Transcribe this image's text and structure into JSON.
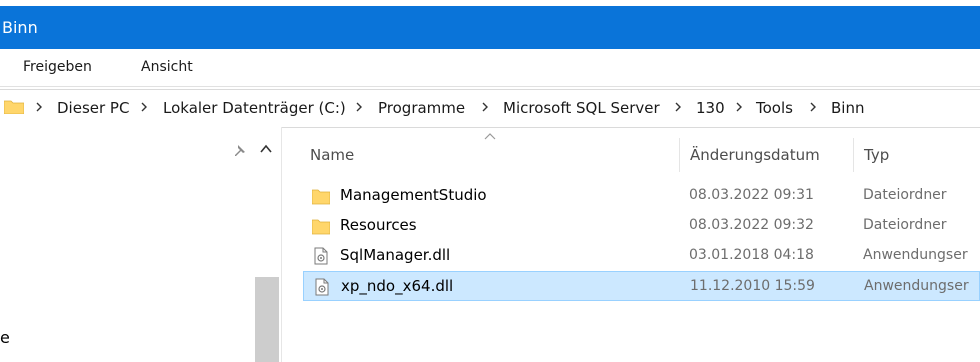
{
  "window": {
    "title": "Binn"
  },
  "ribbon": {
    "tabs": [
      "Freigeben",
      "Ansicht"
    ]
  },
  "breadcrumb": [
    "Dieser PC",
    "Lokaler Datenträger (C:)",
    "Programme",
    "Microsoft SQL Server",
    "130",
    "Tools",
    "Binn"
  ],
  "navpane": {
    "partial_label": "e"
  },
  "columns": {
    "name": "Name",
    "date": "Änderungsdatum",
    "type": "Typ"
  },
  "files": [
    {
      "name": "ManagementStudio",
      "date": "08.03.2022 09:31",
      "type": "Dateiordner",
      "icon": "folder-icon"
    },
    {
      "name": "Resources",
      "date": "08.03.2022 09:32",
      "type": "Dateiordner",
      "icon": "folder-icon"
    },
    {
      "name": "SqlManager.dll",
      "date": "03.01.2018 04:18",
      "type": "Anwendungser",
      "icon": "dll-file-icon"
    },
    {
      "name": "xp_ndo_x64.dll",
      "date": "11.12.2010 15:59",
      "type": "Anwendungser",
      "icon": "dll-file-icon",
      "selected": true
    }
  ],
  "colors": {
    "titlebar": "#0a74d9",
    "selection": "#cce8ff",
    "selection_border": "#99d1ff",
    "folder": "#ffd66b"
  }
}
